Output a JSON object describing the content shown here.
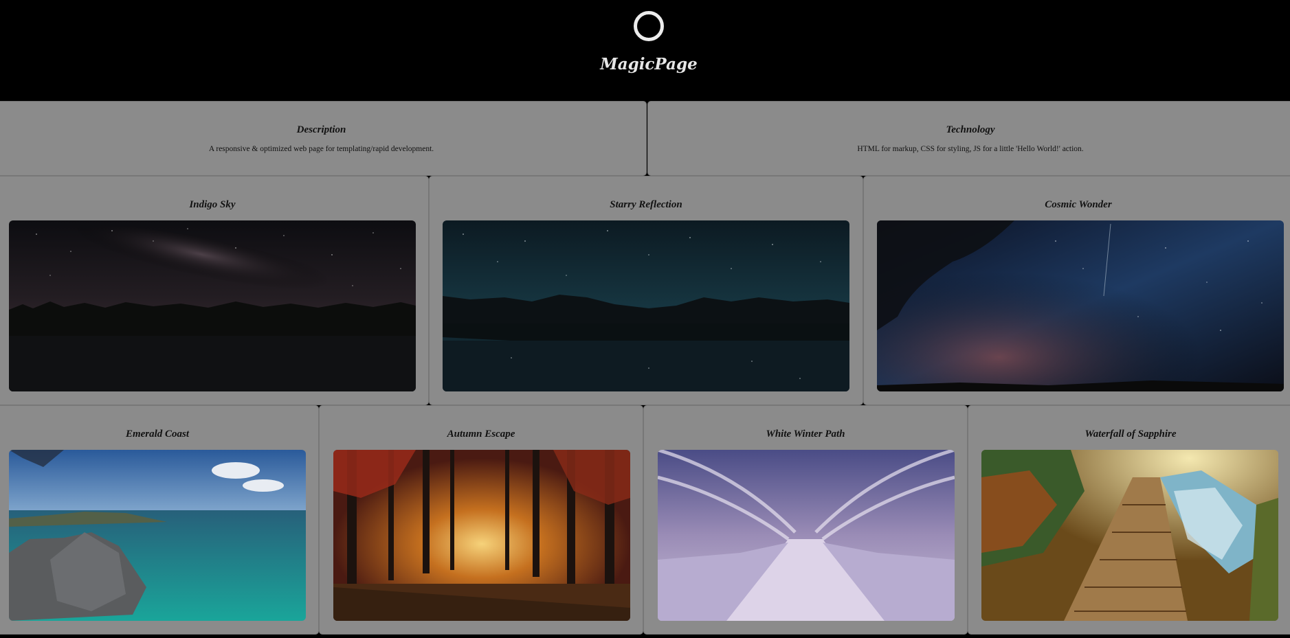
{
  "site": {
    "title": "MagicPage",
    "logo_icon": "circle-logo-icon"
  },
  "info": [
    {
      "heading": "Description",
      "text": "A responsive & optimized web page for templating/rapid development."
    },
    {
      "heading": "Technology",
      "text": "HTML for markup, CSS for styling, JS for a little 'Hello World!' action."
    }
  ],
  "gallery_row1": [
    {
      "title": "Indigo Sky"
    },
    {
      "title": "Starry Reflection"
    },
    {
      "title": "Cosmic Wonder"
    }
  ],
  "gallery_row2": [
    {
      "title": "Emerald Coast"
    },
    {
      "title": "Autumn Escape"
    },
    {
      "title": "White Winter Path"
    },
    {
      "title": "Waterfall of Sapphire"
    }
  ],
  "colors": {
    "background": "#000000",
    "panel": "#8b8b8b",
    "header_text": "#e6e6e6"
  }
}
